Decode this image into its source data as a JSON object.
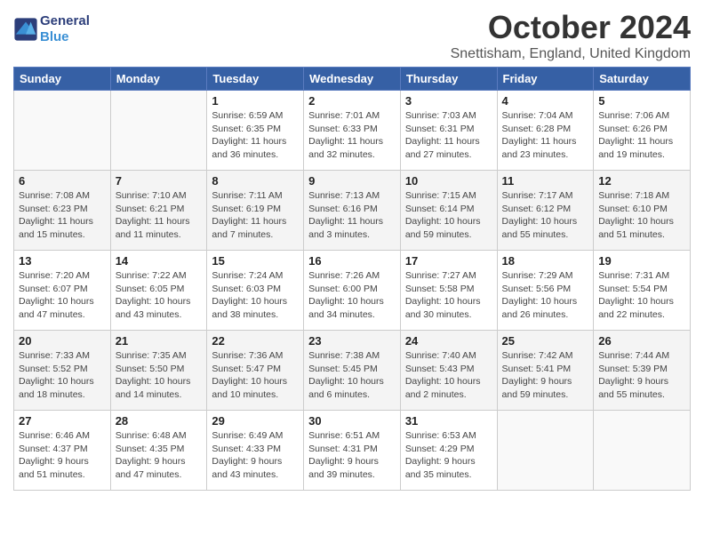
{
  "header": {
    "logo_line1": "General",
    "logo_line2": "Blue",
    "month_title": "October 2024",
    "location": "Snettisham, England, United Kingdom"
  },
  "days_of_week": [
    "Sunday",
    "Monday",
    "Tuesday",
    "Wednesday",
    "Thursday",
    "Friday",
    "Saturday"
  ],
  "weeks": [
    [
      {
        "day": "",
        "info": ""
      },
      {
        "day": "",
        "info": ""
      },
      {
        "day": "1",
        "info": "Sunrise: 6:59 AM\nSunset: 6:35 PM\nDaylight: 11 hours and 36 minutes."
      },
      {
        "day": "2",
        "info": "Sunrise: 7:01 AM\nSunset: 6:33 PM\nDaylight: 11 hours and 32 minutes."
      },
      {
        "day": "3",
        "info": "Sunrise: 7:03 AM\nSunset: 6:31 PM\nDaylight: 11 hours and 27 minutes."
      },
      {
        "day": "4",
        "info": "Sunrise: 7:04 AM\nSunset: 6:28 PM\nDaylight: 11 hours and 23 minutes."
      },
      {
        "day": "5",
        "info": "Sunrise: 7:06 AM\nSunset: 6:26 PM\nDaylight: 11 hours and 19 minutes."
      }
    ],
    [
      {
        "day": "6",
        "info": "Sunrise: 7:08 AM\nSunset: 6:23 PM\nDaylight: 11 hours and 15 minutes."
      },
      {
        "day": "7",
        "info": "Sunrise: 7:10 AM\nSunset: 6:21 PM\nDaylight: 11 hours and 11 minutes."
      },
      {
        "day": "8",
        "info": "Sunrise: 7:11 AM\nSunset: 6:19 PM\nDaylight: 11 hours and 7 minutes."
      },
      {
        "day": "9",
        "info": "Sunrise: 7:13 AM\nSunset: 6:16 PM\nDaylight: 11 hours and 3 minutes."
      },
      {
        "day": "10",
        "info": "Sunrise: 7:15 AM\nSunset: 6:14 PM\nDaylight: 10 hours and 59 minutes."
      },
      {
        "day": "11",
        "info": "Sunrise: 7:17 AM\nSunset: 6:12 PM\nDaylight: 10 hours and 55 minutes."
      },
      {
        "day": "12",
        "info": "Sunrise: 7:18 AM\nSunset: 6:10 PM\nDaylight: 10 hours and 51 minutes."
      }
    ],
    [
      {
        "day": "13",
        "info": "Sunrise: 7:20 AM\nSunset: 6:07 PM\nDaylight: 10 hours and 47 minutes."
      },
      {
        "day": "14",
        "info": "Sunrise: 7:22 AM\nSunset: 6:05 PM\nDaylight: 10 hours and 43 minutes."
      },
      {
        "day": "15",
        "info": "Sunrise: 7:24 AM\nSunset: 6:03 PM\nDaylight: 10 hours and 38 minutes."
      },
      {
        "day": "16",
        "info": "Sunrise: 7:26 AM\nSunset: 6:00 PM\nDaylight: 10 hours and 34 minutes."
      },
      {
        "day": "17",
        "info": "Sunrise: 7:27 AM\nSunset: 5:58 PM\nDaylight: 10 hours and 30 minutes."
      },
      {
        "day": "18",
        "info": "Sunrise: 7:29 AM\nSunset: 5:56 PM\nDaylight: 10 hours and 26 minutes."
      },
      {
        "day": "19",
        "info": "Sunrise: 7:31 AM\nSunset: 5:54 PM\nDaylight: 10 hours and 22 minutes."
      }
    ],
    [
      {
        "day": "20",
        "info": "Sunrise: 7:33 AM\nSunset: 5:52 PM\nDaylight: 10 hours and 18 minutes."
      },
      {
        "day": "21",
        "info": "Sunrise: 7:35 AM\nSunset: 5:50 PM\nDaylight: 10 hours and 14 minutes."
      },
      {
        "day": "22",
        "info": "Sunrise: 7:36 AM\nSunset: 5:47 PM\nDaylight: 10 hours and 10 minutes."
      },
      {
        "day": "23",
        "info": "Sunrise: 7:38 AM\nSunset: 5:45 PM\nDaylight: 10 hours and 6 minutes."
      },
      {
        "day": "24",
        "info": "Sunrise: 7:40 AM\nSunset: 5:43 PM\nDaylight: 10 hours and 2 minutes."
      },
      {
        "day": "25",
        "info": "Sunrise: 7:42 AM\nSunset: 5:41 PM\nDaylight: 9 hours and 59 minutes."
      },
      {
        "day": "26",
        "info": "Sunrise: 7:44 AM\nSunset: 5:39 PM\nDaylight: 9 hours and 55 minutes."
      }
    ],
    [
      {
        "day": "27",
        "info": "Sunrise: 6:46 AM\nSunset: 4:37 PM\nDaylight: 9 hours and 51 minutes."
      },
      {
        "day": "28",
        "info": "Sunrise: 6:48 AM\nSunset: 4:35 PM\nDaylight: 9 hours and 47 minutes."
      },
      {
        "day": "29",
        "info": "Sunrise: 6:49 AM\nSunset: 4:33 PM\nDaylight: 9 hours and 43 minutes."
      },
      {
        "day": "30",
        "info": "Sunrise: 6:51 AM\nSunset: 4:31 PM\nDaylight: 9 hours and 39 minutes."
      },
      {
        "day": "31",
        "info": "Sunrise: 6:53 AM\nSunset: 4:29 PM\nDaylight: 9 hours and 35 minutes."
      },
      {
        "day": "",
        "info": ""
      },
      {
        "day": "",
        "info": ""
      }
    ]
  ]
}
